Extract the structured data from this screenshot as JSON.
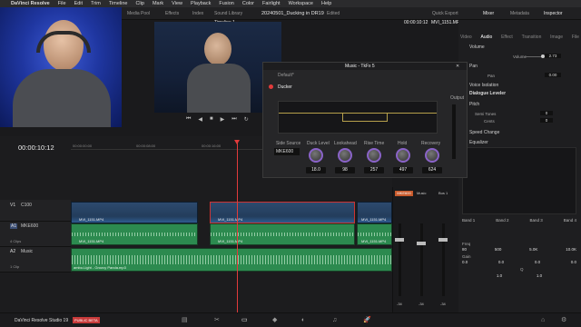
{
  "menubar": {
    "apple": "",
    "app": "DaVinci Resolve",
    "items": [
      "File",
      "Edit",
      "Trim",
      "Timeline",
      "Clip",
      "Mark",
      "View",
      "Playback",
      "Fusion",
      "Color",
      "Fairlight",
      "Workspace",
      "Help"
    ]
  },
  "toolbar": {
    "media_pool": "Media Pool",
    "effects": "Effects",
    "index": "Index",
    "sound_library": "Sound Library",
    "project": "20240501_Ducking in DR19",
    "edited": "Edited",
    "quick_export": "Quick Export",
    "mixer": "Mixer",
    "metadata": "Metadata",
    "inspector": "Inspector"
  },
  "viewer": {
    "timeline_name": "Timeline 1",
    "timecode": "00:00:10:12",
    "clip_name": "MVI_1151.MP4"
  },
  "inspector": {
    "tabs": [
      "Video",
      "Audio",
      "Effect",
      "Transition",
      "Image",
      "File"
    ],
    "volume": "Volume",
    "volume_label": "Volume",
    "volume_value": "2.73",
    "pan": "Pan",
    "pan_label": "Pan",
    "pan_value": "0.00",
    "voice_isolation": "Voice Isolation",
    "dialogue_leveler": "Dialogue Leveler",
    "pitch": "Pitch",
    "semi_tones": "Semi Tones",
    "semi_value": "0",
    "cents": "Cents",
    "cents_value": "0",
    "speed_change": "Speed Change",
    "equalizer": "Equalizer",
    "bands": [
      "Band 1",
      "Band 2",
      "Band 3",
      "Band 4"
    ],
    "freq_label": "Freq",
    "freqs": [
      "80",
      "500",
      "5.0K",
      "10.0K"
    ],
    "gain_label": "Gain",
    "gains": [
      "0.0",
      "0.0",
      "0.0",
      "0.0"
    ],
    "q_label": "Q",
    "qs": [
      "",
      "1.0",
      "1.0",
      ""
    ]
  },
  "panel": {
    "title": "Music - TkFx 5",
    "preset": "Default*",
    "plugin": "Ducker",
    "output": "Output",
    "side_source": "Side Source",
    "side_value": "MKE600",
    "knobs": [
      {
        "label": "Duck Level",
        "sub": "Min  dB  Max",
        "value": "18.0"
      },
      {
        "label": "Lookahead",
        "sub": "",
        "value": "98"
      },
      {
        "label": "Rise Time",
        "sub": "",
        "value": "257"
      },
      {
        "label": "Hold",
        "sub": "",
        "value": "497"
      },
      {
        "label": "Recovery",
        "sub": "",
        "value": "624"
      }
    ]
  },
  "timeline": {
    "timecode": "00:00:10:12",
    "ruler": [
      "00:00:00:00",
      "00:00:08:00",
      "00:00:16:00",
      "00:00:24:00"
    ],
    "tracks": [
      {
        "id": "V1",
        "name": "C100",
        "clips": "1 Clip"
      },
      {
        "id": "A1",
        "name": "MKE600",
        "clips": "4 Clips"
      },
      {
        "id": "A2",
        "name": "Music",
        "clips": "1 Clip"
      }
    ],
    "video_clips": [
      "MVI_1151.MP4",
      "MVI_1151.MP4",
      "MVI_1151.MP4"
    ],
    "audio_clips": [
      "MVI_1151.MP4",
      "MVI_1151.MP4",
      "MVI_1151.MP4"
    ],
    "music_clip": "ambo.Light - Groovy Panda.mp3"
  },
  "mixer": {
    "channels": [
      "MKE600",
      "Music",
      "Bus 1"
    ],
    "levels": [
      "-34",
      "-34",
      "-34"
    ]
  },
  "bottombar": {
    "app": "DaVinci Resolve Studio 19",
    "badge": "PUBLIC BETA"
  },
  "colors": {
    "accent": "#e23b3b",
    "purple": "#8a63c8",
    "video_clip": "#2d4a6e",
    "audio_clip": "#2c8a4f"
  }
}
